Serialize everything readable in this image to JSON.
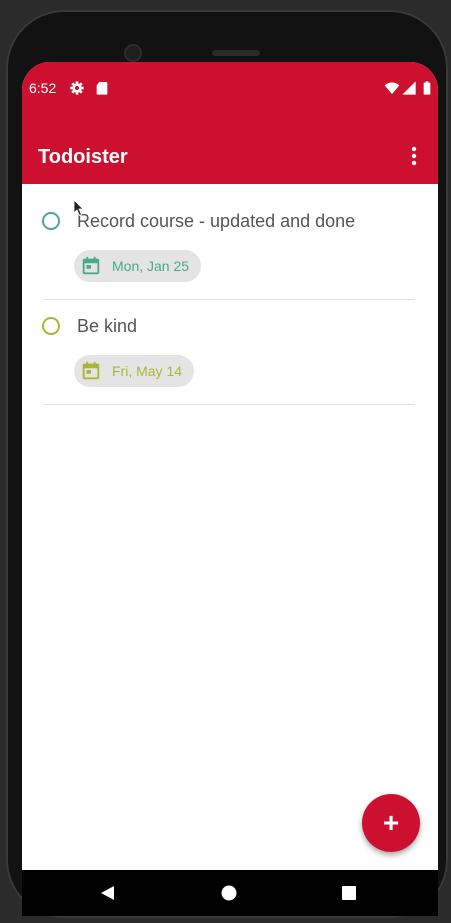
{
  "status_bar": {
    "time": "6:52",
    "icons": [
      "settings-icon",
      "sd-card-icon",
      "wifi-icon",
      "signal-icon",
      "battery-icon"
    ]
  },
  "app_bar": {
    "title": "Todoister",
    "menu_icon": "more-vert-icon",
    "color": "#cd1030"
  },
  "tasks": [
    {
      "title": "Record course - updated and done",
      "due": "Mon, Jan 25",
      "color": "#4aa98a"
    },
    {
      "title": "Be kind",
      "due": "Fri, May 14",
      "color": "#a7b735"
    }
  ],
  "fab": {
    "label": "+",
    "icon": "add-icon",
    "color": "#cd1030"
  },
  "nav_bar": {
    "buttons": [
      "back-icon",
      "home-icon",
      "recents-icon"
    ]
  }
}
